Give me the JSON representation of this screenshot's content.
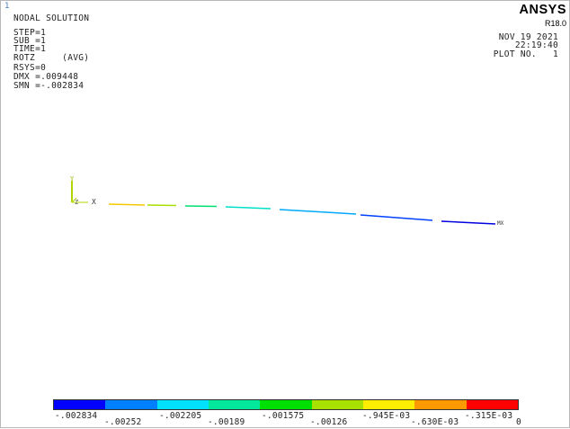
{
  "window_number": "1",
  "brand": "ANSYS",
  "release": "R18.0",
  "info_lines": [
    "NODAL SOLUTION",
    "STEP=1",
    "SUB =1",
    "TIME=1",
    "ROTZ     (AVG)",
    "RSYS=0",
    "DMX =.009448",
    "SMN =-.002834"
  ],
  "date_lines": [
    "NOV 19 2021",
    "22:19:40",
    "PLOT NO.   1"
  ],
  "axis": {
    "y": "Y",
    "z": "Z",
    "x": "X"
  },
  "node_label": "MX",
  "legend": {
    "colors": [
      "#0000ff",
      "#0080ff",
      "#00e0ff",
      "#00e89b",
      "#00e000",
      "#a8e000",
      "#ffee00",
      "#ff9900",
      "#ff0000"
    ],
    "labels_top": [
      "-.002834",
      "-.002205",
      "-.001575",
      "-.945E-03",
      "-.315E-03"
    ],
    "labels_bottom": [
      "-.00252",
      "-.00189",
      "-.00126",
      "-.630E-03",
      "0"
    ]
  }
}
